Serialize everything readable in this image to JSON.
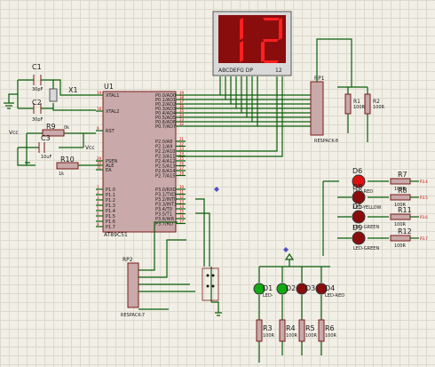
{
  "display": {
    "digits": "12",
    "seg_labels": "ABCDEFG DP",
    "right_label": "12"
  },
  "u1": {
    "ref": "U1",
    "part": "AT89C51",
    "left_pins": [
      "XTAL1",
      "XTAL2",
      "RST",
      "PSEN",
      "ALE",
      "EA",
      "P1.0",
      "P1.1",
      "P1.2",
      "P1.3",
      "P1.4",
      "P1.5",
      "P1.6",
      "P1.7"
    ],
    "left_nums": [
      "19",
      "18",
      "9",
      "29",
      "30",
      "31",
      "1",
      "2",
      "3",
      "4",
      "5",
      "6",
      "7",
      "8"
    ],
    "p0_pins": [
      "P0.0/AD0",
      "P0.1/AD1",
      "P0.2/AD2",
      "P0.3/AD3",
      "P0.4/AD4",
      "P0.5/AD5",
      "P0.6/AD6",
      "P0.7/AD7"
    ],
    "p0_nums": [
      "39",
      "38",
      "37",
      "36",
      "35",
      "34",
      "33",
      "32"
    ],
    "p2_pins": [
      "P2.0/A8",
      "P2.1/A9",
      "P2.2/A10",
      "P2.3/A11",
      "P2.4/A12",
      "P2.5/A13",
      "P2.6/A14",
      "P2.7/A15"
    ],
    "p2_nums": [
      "21",
      "22",
      "23",
      "24",
      "25",
      "26",
      "27",
      "28"
    ],
    "p3_pins": [
      "P3.0/RXD",
      "P3.1/TXD",
      "P3.2/INT0",
      "P3.3/INT1",
      "P3.4/T0",
      "P3.5/T1",
      "P3.6/WR",
      "P3.7/RD"
    ],
    "p3_nums": [
      "10",
      "11",
      "12",
      "13",
      "14",
      "15",
      "16",
      "17"
    ]
  },
  "components": {
    "c1": {
      "ref": "C1",
      "value": "30pF"
    },
    "c2": {
      "ref": "C2",
      "value": "30pF"
    },
    "x1": {
      "ref": "X1"
    },
    "r9": {
      "ref": "R9",
      "value": "0k"
    },
    "c3": {
      "ref": "C3",
      "value": "10uF"
    },
    "r10": {
      "ref": "R10",
      "value": "1k"
    },
    "vcc1": "Vcc",
    "vcc2": "Vcc",
    "rp1": {
      "ref": "RP1",
      "part": "RESPACK-8"
    },
    "rp2": {
      "ref": "RP2",
      "part": "RESPACK-7"
    },
    "r1": {
      "ref": "R1",
      "value": "100R"
    },
    "r2": {
      "ref": "R2",
      "value": "100R"
    },
    "right_leds": [
      {
        "ref": "D6",
        "label": "LED-RED"
      },
      {
        "ref": "D8",
        "label": "LED-YELLOW"
      },
      {
        "ref": "D5",
        "label": "LED-GREEN"
      },
      {
        "ref": "D9",
        "label": "LED-GREEN"
      }
    ],
    "right_res": [
      {
        "ref": "R7",
        "value": "100R"
      },
      {
        "ref": "R8",
        "value": "100R"
      },
      {
        "ref": "R11",
        "value": "100R"
      },
      {
        "ref": "R12",
        "value": "100R"
      }
    ],
    "bottom_leds": [
      {
        "ref": "D1",
        "label": "LED-"
      },
      {
        "ref": "D2",
        "label": ""
      },
      {
        "ref": "D3",
        "label": ""
      },
      {
        "ref": "D4",
        "label": "LED-RED"
      }
    ],
    "bottom_res": [
      {
        "ref": "R3",
        "value": "100R"
      },
      {
        "ref": "R4",
        "value": "100R"
      },
      {
        "ref": "R5",
        "value": "100R"
      },
      {
        "ref": "R6",
        "value": "100R"
      }
    ],
    "net_tags": [
      "P3.4",
      "P3.5",
      "P3.6",
      "P3.7"
    ]
  },
  "colors": {
    "wire": "#0b5f0b",
    "body": "#c9a9a9",
    "seg_on": "#ff2020",
    "seg_off": "#4a0000",
    "led_red": "#d11",
    "led_green": "#1a1"
  }
}
